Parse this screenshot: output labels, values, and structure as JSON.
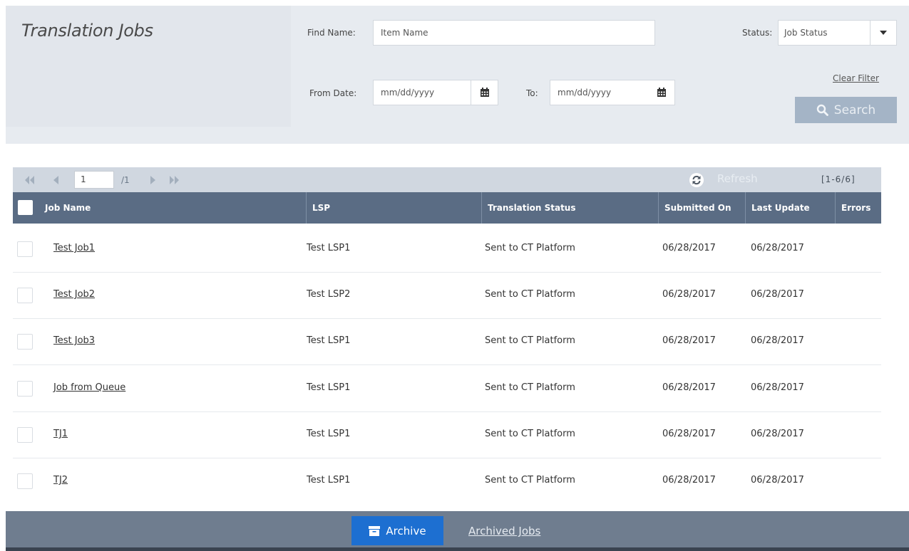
{
  "page": {
    "title": "Translation Jobs"
  },
  "filters": {
    "find_name_label": "Find Name:",
    "find_name_placeholder": "Item Name",
    "status_label": "Status:",
    "status_value": "Job Status",
    "from_label": "From Date:",
    "from_placeholder": "mm/dd/yyyy",
    "to_label": "To:",
    "to_placeholder": "mm/dd/yyyy",
    "clear_filter": "Clear Filter",
    "search_label": "Search"
  },
  "pager": {
    "current_page": "1",
    "total_pages": "/1",
    "refresh_label": "Refresh",
    "range": "[1-6/6]"
  },
  "table": {
    "columns": [
      "Job Name",
      "LSP",
      "Translation Status",
      "Submitted On",
      "Last Update",
      "Errors"
    ],
    "rows": [
      {
        "job": "Test Job1",
        "lsp": "Test LSP1",
        "status": "Sent to CT Platform",
        "submitted": "06/28/2017",
        "updated": "06/28/2017",
        "errors": ""
      },
      {
        "job": "Test Job2",
        "lsp": "Test LSP2",
        "status": "Sent to CT Platform",
        "submitted": "06/28/2017",
        "updated": "06/28/2017",
        "errors": ""
      },
      {
        "job": "Test Job3",
        "lsp": "Test LSP1",
        "status": "Sent to CT Platform",
        "submitted": "06/28/2017",
        "updated": "06/28/2017",
        "errors": ""
      },
      {
        "job": "Job from Queue",
        "lsp": "Test LSP1",
        "status": "Sent to CT Platform",
        "submitted": "06/28/2017",
        "updated": "06/28/2017",
        "errors": ""
      },
      {
        "job": "TJ1",
        "lsp": "Test LSP1",
        "status": "Sent to CT Platform",
        "submitted": "06/28/2017",
        "updated": "06/28/2017",
        "errors": ""
      },
      {
        "job": "TJ2",
        "lsp": "Test LSP1",
        "status": "Sent to CT Platform",
        "submitted": "06/28/2017",
        "updated": "06/28/2017",
        "errors": ""
      }
    ]
  },
  "footer": {
    "archive_label": "Archive",
    "archived_jobs_label": "Archived Jobs"
  },
  "colors": {
    "header_bg": "#5a6c84",
    "footer_bg": "#6f7d8f",
    "archive_button": "#1d6fd1",
    "search_button": "#a4b4c6"
  }
}
